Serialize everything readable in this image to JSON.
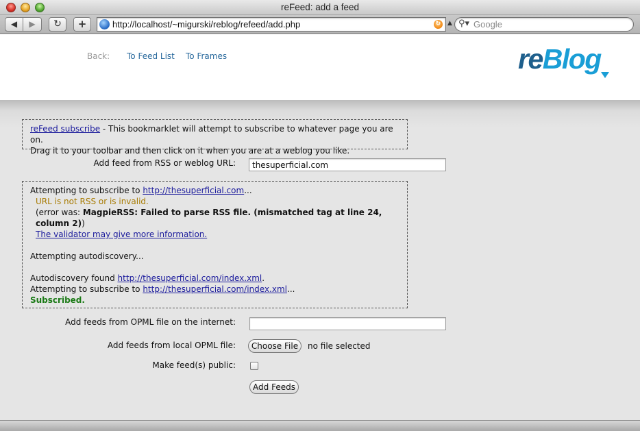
{
  "window": {
    "title": "reFeed: add a feed"
  },
  "toolbar": {
    "back_glyph": "◀",
    "forward_glyph": "▶",
    "reload_glyph": "↻",
    "add_glyph": "+",
    "url": "http://localhost/~migurski/reblog/refeed/add.php",
    "search_placeholder": "Google"
  },
  "header": {
    "nav_back": "Back:",
    "nav_feed_list": "To Feed List",
    "nav_frames": "To Frames",
    "logo_re": "re",
    "logo_blog": "Blog",
    "logo_colors": {
      "re": "#1e5f8c",
      "blog": "#1a9ed6"
    }
  },
  "bookmarklet": {
    "link": "reFeed subscribe",
    "text1": " - This bookmarklet will attempt to subscribe to whatever page you are on.",
    "text2": "Drag it to your toolbar and then click on it when you are at a weblog you like."
  },
  "add_feed": {
    "label": "Add feed from RSS or weblog URL:",
    "value": "thesuperficial.com"
  },
  "status_log": {
    "attempt_prefix": "Attempting to subscribe to ",
    "attempt_url": "http://thesuperficial.com",
    "ellipsis": "...",
    "invalid": "URL is not RSS or is invalid.",
    "error_prefix": "(error was: ",
    "error_message": "MagpieRSS: Failed to parse RSS file. (mismatched tag at line 24, column 2)",
    "error_suffix": ")",
    "validator_link": "The validator may give more information.",
    "autodiscovery": "Attempting autodiscovery...",
    "found_prefix": "Autodiscovery found ",
    "found_url": "http://thesuperficial.com/index.xml",
    "found_suffix": ".",
    "attempt2_prefix": "Attempting to subscribe to ",
    "attempt2_url": "http://thesuperficial.com/index.xml",
    "attempt2_suffix": "...",
    "subscribed": "Subscribed."
  },
  "opml_internet": {
    "label": "Add feeds from OPML file on the internet:",
    "value": ""
  },
  "opml_local": {
    "label": "Add feeds from local OPML file:",
    "button": "Choose File",
    "file_status": "no file selected"
  },
  "public": {
    "label": "Make feed(s) public:",
    "checked": false
  },
  "submit": {
    "label": "Add Feeds"
  }
}
